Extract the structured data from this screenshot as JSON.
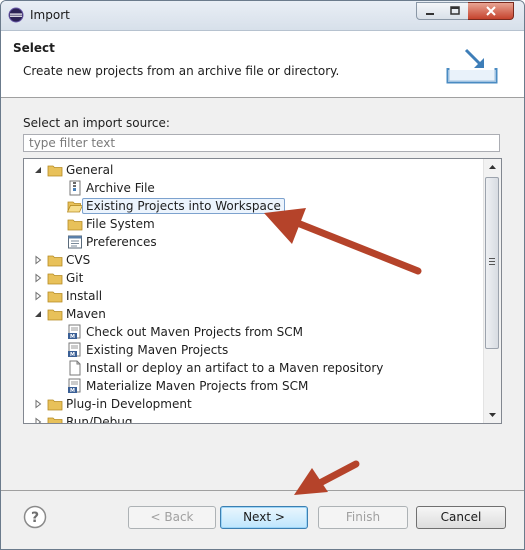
{
  "window": {
    "title": "Import"
  },
  "header": {
    "title": "Select",
    "description": "Create new projects from an archive file or directory."
  },
  "source": {
    "label": "Select an import source:",
    "filter_placeholder": "type filter text"
  },
  "tree": {
    "items": [
      {
        "label": "General",
        "level": 0,
        "expanded": true,
        "icon": "folder-icon"
      },
      {
        "label": "Archive File",
        "level": 1,
        "icon": "archive-file-icon"
      },
      {
        "label": "Existing Projects into Workspace",
        "level": 1,
        "icon": "open-folder-icon",
        "selected": true
      },
      {
        "label": "File System",
        "level": 1,
        "icon": "folder-icon"
      },
      {
        "label": "Preferences",
        "level": 1,
        "icon": "preferences-icon"
      },
      {
        "label": "CVS",
        "level": 0,
        "expanded": false,
        "icon": "folder-icon"
      },
      {
        "label": "Git",
        "level": 0,
        "expanded": false,
        "icon": "folder-icon"
      },
      {
        "label": "Install",
        "level": 0,
        "expanded": false,
        "icon": "folder-icon"
      },
      {
        "label": "Maven",
        "level": 0,
        "expanded": true,
        "icon": "folder-icon"
      },
      {
        "label": "Check out Maven Projects from SCM",
        "level": 1,
        "icon": "maven-icon"
      },
      {
        "label": "Existing Maven Projects",
        "level": 1,
        "icon": "maven-icon"
      },
      {
        "label": "Install or deploy an artifact to a Maven repository",
        "level": 1,
        "icon": "file-icon"
      },
      {
        "label": "Materialize Maven Projects from SCM",
        "level": 1,
        "icon": "maven-icon"
      },
      {
        "label": "Plug-in Development",
        "level": 0,
        "expanded": false,
        "icon": "folder-icon"
      },
      {
        "label": "Run/Debug",
        "level": 0,
        "expanded": false,
        "icon": "folder-icon"
      }
    ]
  },
  "buttons": {
    "back": "< Back",
    "next": "Next >",
    "finish": "Finish",
    "cancel": "Cancel"
  },
  "colors": {
    "annotation_arrow": "#b5432a",
    "selection_border": "#7da2ce",
    "folder": "#e8c15a"
  }
}
